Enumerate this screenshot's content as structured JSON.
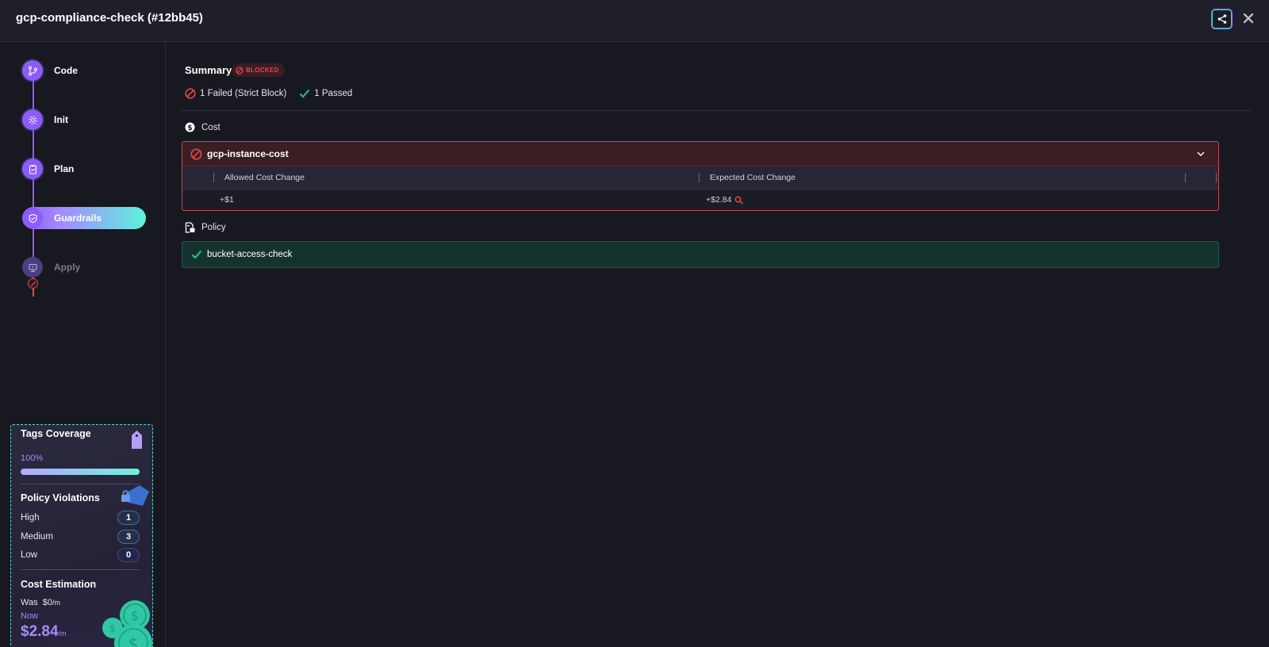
{
  "header": {
    "title": "gcp-compliance-check (#12bb45)",
    "share_icon": "share-icon",
    "close_icon": "close-icon"
  },
  "steps": [
    {
      "label": "Code",
      "icon": "code-branch-icon",
      "state": "done"
    },
    {
      "label": "Init",
      "icon": "gear-icon",
      "state": "done"
    },
    {
      "label": "Plan",
      "icon": "clipboard-icon",
      "state": "done"
    },
    {
      "label": "Guardrails",
      "icon": "shield-icon",
      "state": "active"
    },
    {
      "label": "Apply",
      "icon": "deploy-icon",
      "state": "disabled"
    }
  ],
  "stats": {
    "tags_coverage": {
      "title": "Tags Coverage",
      "percent_label": "100%",
      "percent": 100
    },
    "policy_violations": {
      "title": "Policy Violations",
      "rows": [
        {
          "label": "High",
          "count": "1"
        },
        {
          "label": "Medium",
          "count": "3"
        },
        {
          "label": "Low",
          "count": "0"
        }
      ]
    },
    "cost_estimation": {
      "title": "Cost Estimation",
      "was_label": "Was",
      "was_value": "$0",
      "was_unit": "/m",
      "now_label": "Now",
      "now_value": "$2.84",
      "now_unit": "/m"
    }
  },
  "summary": {
    "title": "Summary",
    "status_badge": "BLOCKED",
    "failed_text": "1 Failed (Strict Block)",
    "passed_text": "1 Passed"
  },
  "cost_section": {
    "title": "Cost",
    "check": {
      "name": "gcp-instance-cost",
      "columns": [
        "Allowed Cost Change",
        "Expected Cost Change"
      ],
      "row": {
        "allowed": "+$1",
        "expected": "+$2.84"
      }
    }
  },
  "policy_section": {
    "title": "Policy",
    "check": {
      "name": "bucket-access-check"
    }
  },
  "colors": {
    "accent": "#8b5cf6",
    "fail": "#e5484d",
    "pass": "#22c49a",
    "teal": "#5ef2dc"
  }
}
